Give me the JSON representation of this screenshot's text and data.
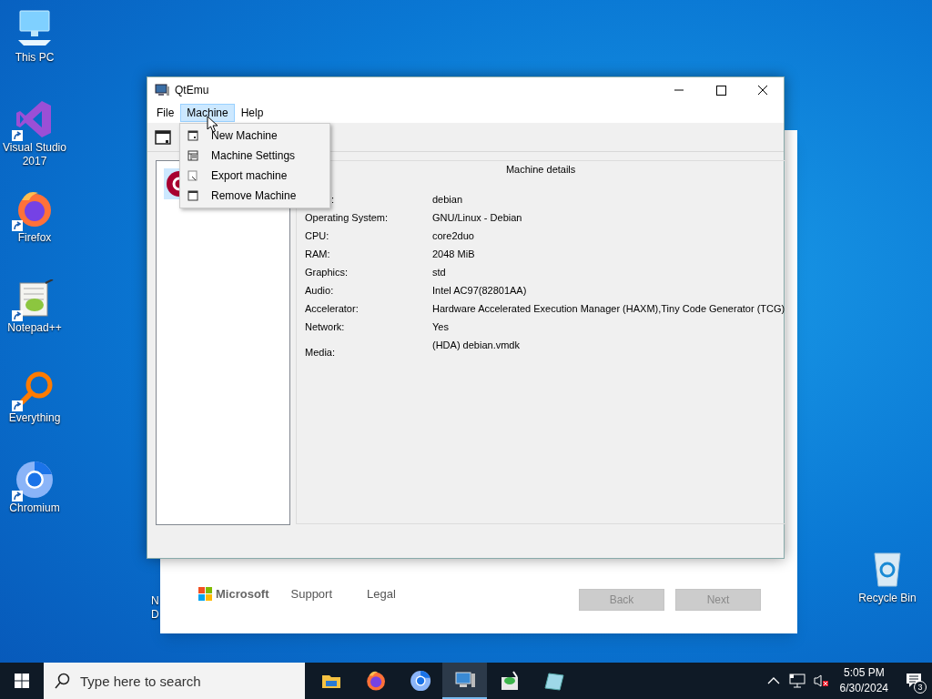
{
  "desktop_icons": [
    {
      "kind": "pc",
      "label": "This PC",
      "shortcut": false
    },
    {
      "kind": "vs",
      "label": "Visual Studio 2017",
      "shortcut": true
    },
    {
      "kind": "firefox",
      "label": "Firefox",
      "shortcut": true
    },
    {
      "kind": "notepad",
      "label": "Notepad++",
      "shortcut": true
    },
    {
      "kind": "everything",
      "label": "Everything",
      "shortcut": true
    },
    {
      "kind": "chromium",
      "label": "Chromium",
      "shortcut": true
    }
  ],
  "recycle_bin": {
    "label": "Recycle Bin"
  },
  "hidden_icon_label": [
    "N",
    "D"
  ],
  "setup_window": {
    "brand": "Microsoft",
    "links": [
      "Support",
      "Legal"
    ],
    "buttons": [
      {
        "label": "Back",
        "disabled": true
      },
      {
        "label": "Next",
        "disabled": true
      }
    ]
  },
  "qtemu_window": {
    "title": "QtEmu",
    "menu": [
      {
        "label": "File",
        "selected": false
      },
      {
        "label": "Machine",
        "selected": true
      },
      {
        "label": "Help",
        "selected": false
      }
    ],
    "dropdown": [
      {
        "kind": "new",
        "label": "New Machine"
      },
      {
        "kind": "settings",
        "label": "Machine Settings"
      },
      {
        "kind": "export",
        "label": "Export machine"
      },
      {
        "kind": "remove",
        "label": "Remove Machine"
      }
    ],
    "machines": [
      {
        "selected": true
      }
    ],
    "details": {
      "title": "Machine details",
      "rows": [
        {
          "label": ":",
          "value": "debian"
        },
        {
          "label": "Operating System:",
          "value": "GNU/Linux - Debian"
        },
        {
          "label": "CPU:",
          "value": "core2duo"
        },
        {
          "label": "RAM:",
          "value": "2048 MiB"
        },
        {
          "label": "Graphics:",
          "value": "std"
        },
        {
          "label": "Audio:",
          "value": "Intel AC97(82801AA)"
        },
        {
          "label": "Accelerator:",
          "value": "Hardware Accelerated Execution Manager (HAXM),Tiny Code Generator (TCG)"
        },
        {
          "label": "Network:",
          "value": "Yes"
        },
        {
          "label": "Media:",
          "value": "(HDA) debian.vmdk"
        }
      ]
    }
  },
  "taskbar": {
    "search": {
      "placeholder": "Type here to search"
    },
    "apps": [
      {
        "kind": "files",
        "active": false
      },
      {
        "kind": "firefox",
        "active": false
      },
      {
        "kind": "chromium",
        "active": false
      },
      {
        "kind": "qtemu",
        "active": true
      },
      {
        "kind": "notepad",
        "active": false
      },
      {
        "kind": "glass",
        "active": false
      }
    ],
    "time": "5:05 PM",
    "date": "6/30/2024",
    "notifications": "3"
  }
}
